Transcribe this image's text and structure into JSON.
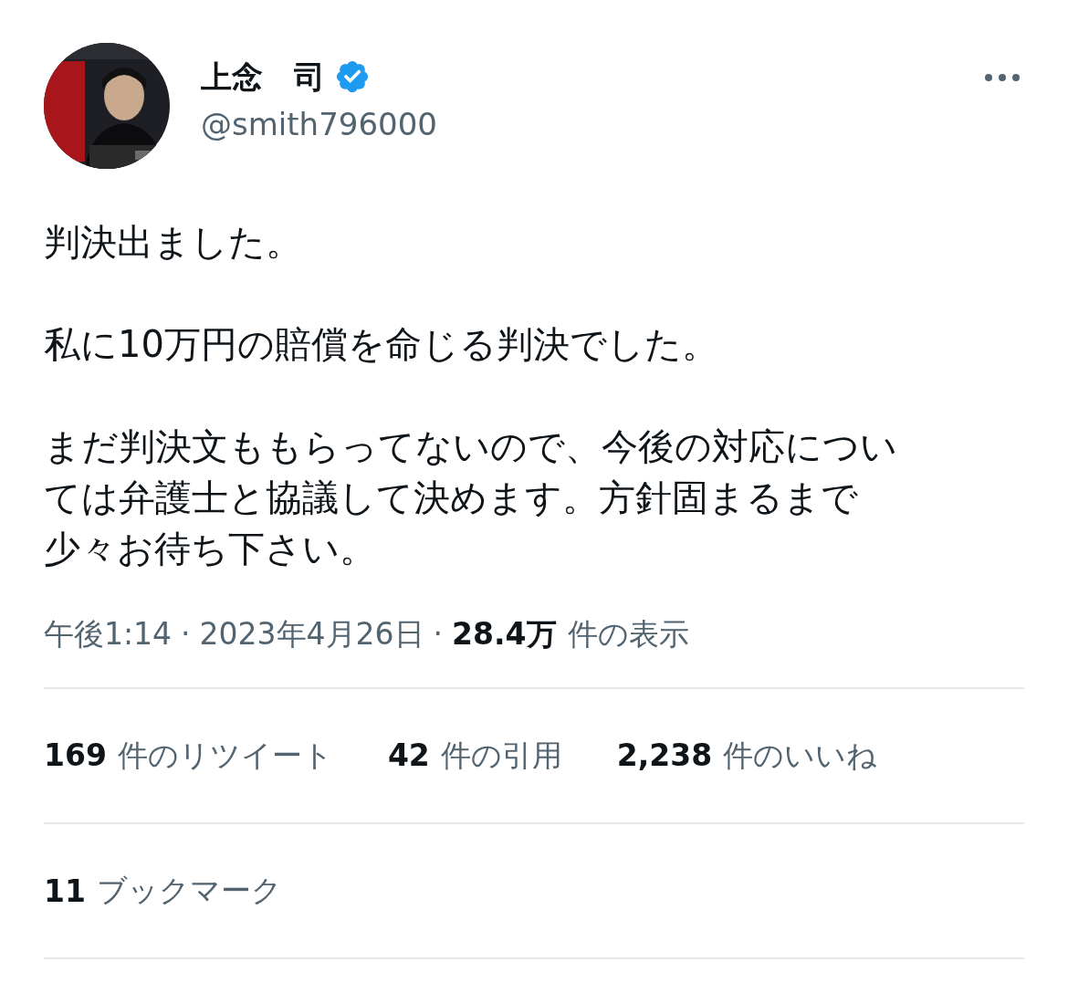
{
  "author": {
    "name": "上念　司",
    "verified": true,
    "handle": "@smith796000"
  },
  "body": [
    {
      "lines": [
        "判決出ました。"
      ]
    },
    {
      "lines": [
        "私に10万円の賠償を命じる判決でした。"
      ]
    },
    {
      "lines": [
        "まだ判決文ももらってないので、今後の対応につい",
        "ては弁護士と協議して決めます。方針固まるまで",
        "少々お待ち下さい。"
      ]
    }
  ],
  "meta": {
    "time": "午後1:14",
    "separator": "·",
    "date": "2023年4月26日",
    "views_count": "28.4万",
    "views_label": "件の表示"
  },
  "stats": [
    {
      "count": "169",
      "label": "件のリツイート"
    },
    {
      "count": "42",
      "label": "件の引用"
    },
    {
      "count": "2,238",
      "label": "件のいいね"
    }
  ],
  "bookmarks": {
    "count": "11",
    "label": "ブックマーク"
  }
}
